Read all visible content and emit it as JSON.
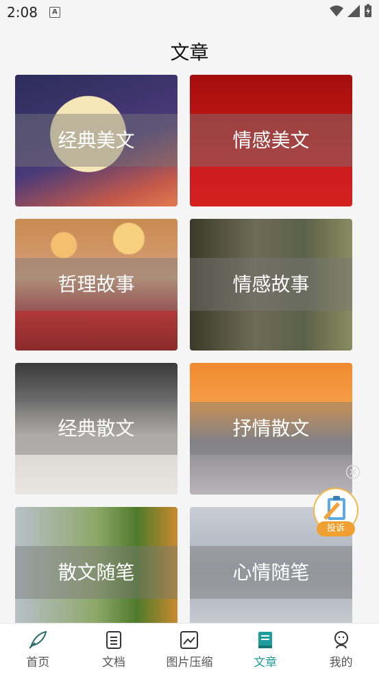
{
  "status": {
    "time": "2:08",
    "badge": "A"
  },
  "title": "文章",
  "cards": [
    {
      "label": "经典美文"
    },
    {
      "label": "情感美文"
    },
    {
      "label": "哲理故事"
    },
    {
      "label": "情感故事"
    },
    {
      "label": "经典散文"
    },
    {
      "label": "抒情散文"
    },
    {
      "label": "散文随笔"
    },
    {
      "label": "心情随笔"
    }
  ],
  "complaint": {
    "label": "投诉"
  },
  "nav": {
    "items": [
      {
        "label": "首页",
        "icon": "feather-icon"
      },
      {
        "label": "文档",
        "icon": "document-icon"
      },
      {
        "label": "图片压缩",
        "icon": "image-icon"
      },
      {
        "label": "文章",
        "icon": "book-icon"
      },
      {
        "label": "我的",
        "icon": "user-icon"
      }
    ],
    "active_color": "#1f9c9c"
  }
}
